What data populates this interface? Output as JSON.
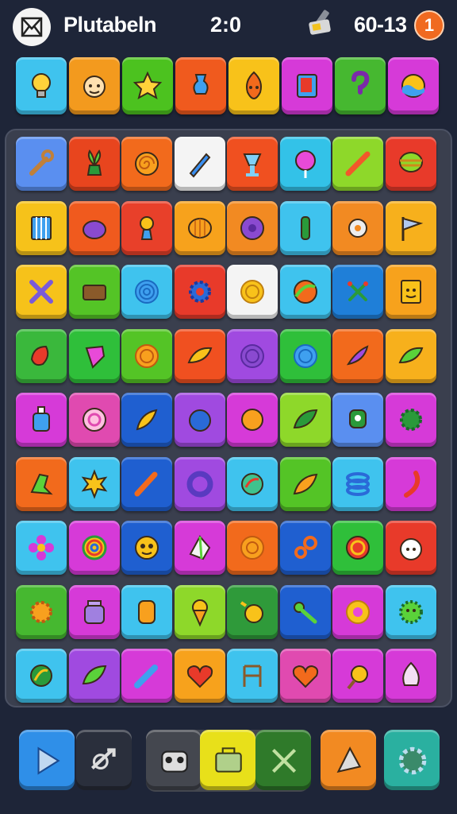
{
  "header": {
    "title": "Plutabeln",
    "timer": "2:0",
    "score": "60-13",
    "notification_count": "1"
  },
  "colors": {
    "background": "#1e2538",
    "board": "#3a3f4e",
    "badge": "#f06a20"
  },
  "top_row": [
    {
      "name": "lightbulb",
      "color": "#3fc3ee"
    },
    {
      "name": "face",
      "color": "#f39a1e"
    },
    {
      "name": "star-blob",
      "color": "#4cc21f"
    },
    {
      "name": "vase",
      "color": "#f05a1e"
    },
    {
      "name": "fire-face",
      "color": "#f8c21a"
    },
    {
      "name": "book",
      "color": "#d63ad8"
    },
    {
      "name": "question",
      "color": "#46b830"
    },
    {
      "name": "wave-ball",
      "color": "#d63ad8"
    }
  ],
  "board": [
    [
      {
        "name": "wrench",
        "color": "#5a8ff0"
      },
      {
        "name": "plant",
        "color": "#e8451e"
      },
      {
        "name": "swirl",
        "color": "#f26a1c"
      },
      {
        "name": "pencil",
        "color": "#f4f4f4"
      },
      {
        "name": "cup",
        "color": "#f05020"
      },
      {
        "name": "lollipop",
        "color": "#33c2e8"
      },
      {
        "name": "wand",
        "color": "#8ed82a"
      },
      {
        "name": "top",
        "color": "#e83a2a"
      }
    ],
    [
      {
        "name": "cage",
        "color": "#f6c21a"
      },
      {
        "name": "pot",
        "color": "#f05a1e"
      },
      {
        "name": "flower-vase",
        "color": "#e8402a"
      },
      {
        "name": "shell",
        "color": "#f7a21c"
      },
      {
        "name": "donut",
        "color": "#f28a22"
      },
      {
        "name": "tube",
        "color": "#3fc3ee"
      },
      {
        "name": "gear",
        "color": "#f28a22"
      },
      {
        "name": "flag",
        "color": "#f7b01c"
      }
    ],
    [
      {
        "name": "cross-tool",
        "color": "#f6c21a"
      },
      {
        "name": "wallet",
        "color": "#54c426"
      },
      {
        "name": "spiral",
        "color": "#3fc3ee"
      },
      {
        "name": "cog",
        "color": "#e83a2a"
      },
      {
        "name": "coin",
        "color": "#f4f4f4"
      },
      {
        "name": "ball",
        "color": "#3fc3ee"
      },
      {
        "name": "cross-sticks",
        "color": "#1f7fd8"
      },
      {
        "name": "picture-face",
        "color": "#f7a21c"
      }
    ],
    [
      {
        "name": "leaf-red",
        "color": "#3ab83c"
      },
      {
        "name": "gem",
        "color": "#2fbf3a"
      },
      {
        "name": "spiral-orange",
        "color": "#54c426"
      },
      {
        "name": "leaf-yellow",
        "color": "#f05020"
      },
      {
        "name": "spiral-purple",
        "color": "#a04ae0"
      },
      {
        "name": "spiral-blue",
        "color": "#2fbf3a"
      },
      {
        "name": "pepper",
        "color": "#f26a1c"
      },
      {
        "name": "leaf-green",
        "color": "#f7b01c"
      }
    ],
    [
      {
        "name": "bottle",
        "color": "#d63ad8"
      },
      {
        "name": "rose",
        "color": "#e04ab0"
      },
      {
        "name": "feather",
        "color": "#1f5fd0"
      },
      {
        "name": "orb",
        "color": "#a04ae0"
      },
      {
        "name": "sun-coin",
        "color": "#d63ad8"
      },
      {
        "name": "leaf",
        "color": "#8ed82a"
      },
      {
        "name": "robot",
        "color": "#5a8ff0"
      },
      {
        "name": "sun-gear",
        "color": "#d63ad8"
      }
    ],
    [
      {
        "name": "boot",
        "color": "#f26a1c"
      },
      {
        "name": "sun",
        "color": "#3fc3ee"
      },
      {
        "name": "brush",
        "color": "#1f5fd0"
      },
      {
        "name": "ring",
        "color": "#a04ae0"
      },
      {
        "name": "leaf-badge",
        "color": "#3fc3ee"
      },
      {
        "name": "feather-orange",
        "color": "#54c426"
      },
      {
        "name": "coil",
        "color": "#3fc3ee"
      },
      {
        "name": "chili",
        "color": "#d63ad8"
      }
    ],
    [
      {
        "name": "flower",
        "color": "#3fc3ee"
      },
      {
        "name": "rainbow-spiral",
        "color": "#d63ad8"
      },
      {
        "name": "mask",
        "color": "#1f5fd0"
      },
      {
        "name": "crystal",
        "color": "#d63ad8"
      },
      {
        "name": "roll",
        "color": "#f26a1c"
      },
      {
        "name": "key-ring",
        "color": "#1f5fd0"
      },
      {
        "name": "candy",
        "color": "#2fbf3a"
      },
      {
        "name": "sheep",
        "color": "#e83a2a"
      }
    ],
    [
      {
        "name": "sun-flower",
        "color": "#46b830"
      },
      {
        "name": "jar",
        "color": "#d63ad8"
      },
      {
        "name": "barrel",
        "color": "#3fc3ee"
      },
      {
        "name": "ice-cream",
        "color": "#8ed82a"
      },
      {
        "name": "duck",
        "color": "#2f9a3a"
      },
      {
        "name": "key",
        "color": "#1f5fd0"
      },
      {
        "name": "coin-gold",
        "color": "#d63ad8"
      },
      {
        "name": "monster",
        "color": "#3fc3ee"
      }
    ],
    [
      {
        "name": "leaf-swirl",
        "color": "#3fc3ee"
      },
      {
        "name": "leaf-plain",
        "color": "#a04ae0"
      },
      {
        "name": "marker",
        "color": "#d63ad8"
      },
      {
        "name": "heart",
        "color": "#f7a21c"
      },
      {
        "name": "chair",
        "color": "#3fc3ee"
      },
      {
        "name": "heart-orange",
        "color": "#e04ab0"
      },
      {
        "name": "bee",
        "color": "#d63ad8"
      },
      {
        "name": "garlic",
        "color": "#d63ad8"
      }
    ]
  ],
  "toolbar": [
    {
      "name": "play",
      "color": "#2f8fe8"
    },
    {
      "name": "shuffle",
      "color": "#2a2f3c"
    },
    {
      "name": "robot-face",
      "color": "#44474f"
    },
    {
      "name": "bag",
      "color": "#e8e01a"
    },
    {
      "name": "crossed",
      "color": "#2f7a2a"
    },
    {
      "name": "pizza",
      "color": "#f28a22"
    },
    {
      "name": "settings",
      "color": "#2ab0a0"
    }
  ]
}
